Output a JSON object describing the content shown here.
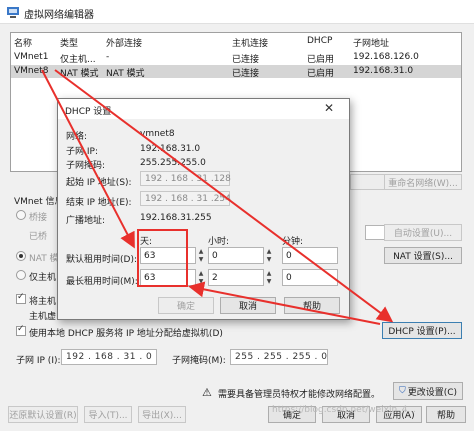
{
  "window": {
    "title": "虚拟网络编辑器"
  },
  "table": {
    "headers": [
      "名称",
      "类型",
      "外部连接",
      "主机连接",
      "DHCP",
      "子网地址"
    ],
    "rows": [
      {
        "name": "VMnet1",
        "type": "仅主机...",
        "external": "-",
        "host": "已连接",
        "dhcp": "已启用",
        "subnet": "192.168.126.0"
      },
      {
        "name": "VMnet8",
        "type": "NAT 模式",
        "external": "NAT 模式",
        "host": "已连接",
        "dhcp": "已启用",
        "subnet": "192.168.31.0"
      }
    ]
  },
  "settings": {
    "vmnet_info_label": "VMnet 信息",
    "bridge_label": "桥接",
    "bridged_to_label": "已桥",
    "nat_label": "NAT 模",
    "host_only_label": "仅主机",
    "connect_host_label": "将主机",
    "host_virtual_label": "主机虚",
    "use_dhcp_label": "使用本地 DHCP 服务将 IP 地址分配给虚拟机(D)",
    "subnet_ip_label": "子网 IP (I):",
    "subnet_ip_value": "192 . 168 . 31 . 0",
    "subnet_mask_label": "子网掩码(M):",
    "subnet_mask_value": "255 . 255 . 255 . 0",
    "rename_network_button": "重命名网络(W)...",
    "auto_settings_button": "自动设置(U)...",
    "nat_settings_button": "NAT 设置(S)...",
    "dhcp_settings_button": "DHCP 设置(P)...",
    "admin_notice": "需要具备管理员特权才能修改网络配置。",
    "change_settings_button": "更改设置(C)"
  },
  "footer": {
    "restore_button": "还原默认设置(R)",
    "import_button": "导入(T)...",
    "export_button": "导出(X)...",
    "ok_button": "确定",
    "cancel_button": "取消",
    "apply_button": "应用(A)",
    "help_button": "帮助"
  },
  "dhcp": {
    "title": "DHCP 设置",
    "network_label": "网络:",
    "network_value": "vmnet8",
    "subnet_ip_label": "子网 IP:",
    "subnet_ip_value": "192.168.31.0",
    "subnet_mask_label": "子网掩码:",
    "subnet_mask_value": "255.255.255.0",
    "start_ip_label": "起始 IP 地址(S):",
    "start_ip_value": "192 . 168 . 31 .128",
    "end_ip_label": "结束 IP 地址(E):",
    "end_ip_value": "192 . 168 . 31 .254",
    "broadcast_label": "广播地址:",
    "broadcast_value": "192.168.31.255",
    "days_label": "天:",
    "hours_label": "小时:",
    "minutes_label": "分钟:",
    "default_lease_label": "默认租用时间(D):",
    "max_lease_label": "最长租用时间(M):",
    "default_days": "63",
    "default_hours": "0",
    "default_minutes": "0",
    "max_days": "63",
    "max_hours": "2",
    "max_minutes": "0",
    "ok_button": "确定",
    "cancel_button": "取消",
    "help_button": "帮助"
  },
  "watermark": "https://blog.csdn.net/weixin_4..."
}
